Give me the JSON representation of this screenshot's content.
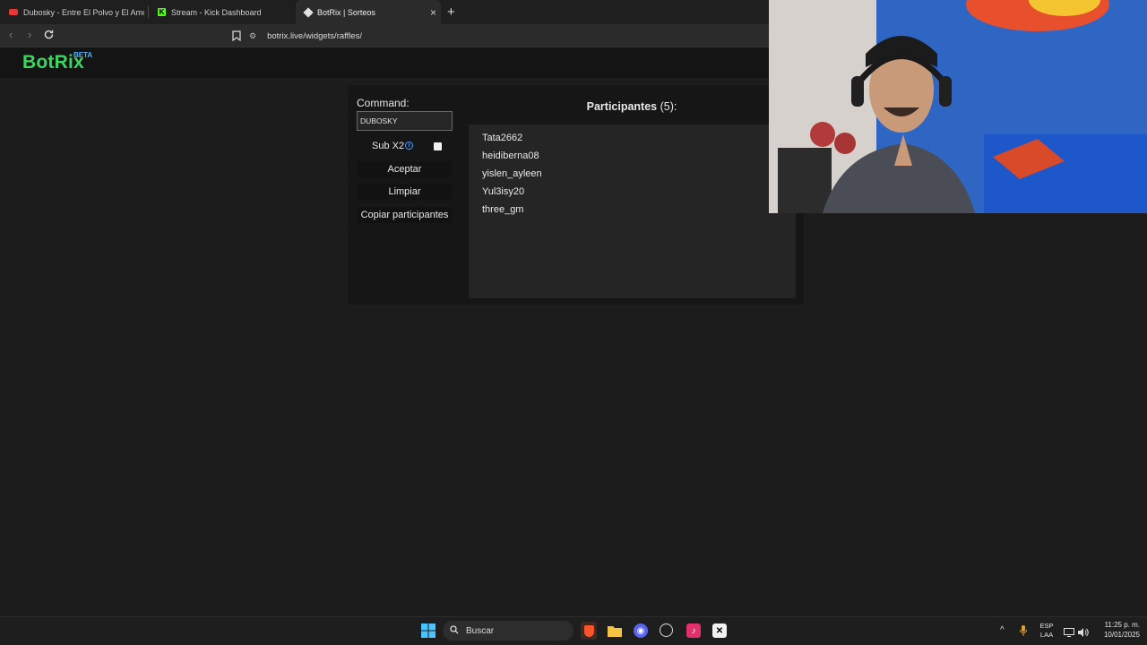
{
  "browser": {
    "tabs": [
      {
        "label": "Dubosky - Entre El Polvo y El Amor [A",
        "color": "#e53935"
      },
      {
        "label": "Stream - Kick Dashboard",
        "color": "#53fc18"
      },
      {
        "label": "BotRix | Sorteos",
        "color": "#e0e0e0"
      }
    ],
    "url": "botrix.live/widgets/raffles/"
  },
  "app": {
    "logo": "BotRix",
    "badge": "BETA",
    "command_label": "Command:",
    "command_value": "DUBOSKY",
    "sub_label": "Sub X2",
    "sub_checked": false,
    "buttons": {
      "accept": "Aceptar",
      "clear": "Limpiar",
      "copy": "Copiar participantes"
    },
    "participants_title": "Participantes",
    "participants_count": "(5):",
    "participants": [
      "Tata2662",
      "heidiberna08",
      "yislen_ayleen",
      "Yul3isy20",
      "three_gm"
    ]
  },
  "taskbar": {
    "search_placeholder": "Buscar",
    "lang_top": "ESP",
    "lang_bottom": "LAA",
    "time": "11:25 p. m.",
    "date": "10/01/2025"
  }
}
